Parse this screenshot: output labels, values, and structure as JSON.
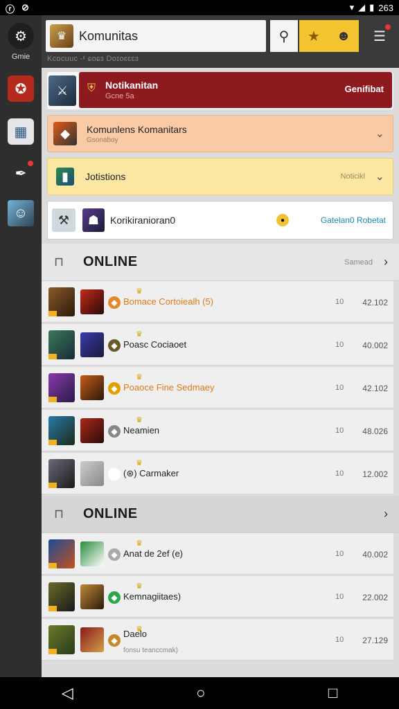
{
  "status": {
    "left1": "ⓡ",
    "left2": "⊘",
    "right": "263"
  },
  "rail": {
    "logo_label": "Gmie"
  },
  "topbar": {
    "title": "Komunitas",
    "subtitle": "Kcocuuc -ᵋ ɕoɕɜ Doɪoɛɛɛɜ"
  },
  "notif": {
    "title": "Notikanitan",
    "sub": "Gcne 5a",
    "right": "Genifibat"
  },
  "cards": [
    {
      "label": "Komunlens Komanitars",
      "sub": "Gsonaboy"
    },
    {
      "label": "Jotistions",
      "right": "Noticikl"
    },
    {
      "label": "Korikiranioran0",
      "right": "Gatelan0 Robetat"
    }
  ],
  "sections": [
    {
      "name": "ONLINE",
      "meta": "Samead"
    },
    {
      "name": "ONLINE",
      "meta": ""
    }
  ],
  "rows1": [
    {
      "name": "Bomace Cortoiealh (5)",
      "c1": "10",
      "c2": "42.102",
      "orange": true
    },
    {
      "name": "Poasc Cociaoet",
      "c1": "10",
      "c2": "40.002",
      "orange": false
    },
    {
      "name": "Poaoce Fine Sedmaey",
      "c1": "10",
      "c2": "42.102",
      "orange": true
    },
    {
      "name": "Neamien",
      "c1": "10",
      "c2": "48.026",
      "orange": false
    },
    {
      "name": "(⊛) Carmaker",
      "c1": "10",
      "c2": "12.002",
      "orange": false
    }
  ],
  "rows2": [
    {
      "name": "Anat de 2ef (e)",
      "c1": "10",
      "c2": "40.002"
    },
    {
      "name": "Kemnagiitaes)",
      "c1": "10",
      "c2": "22.002"
    },
    {
      "name": "Daelo",
      "sub": "fonsu teanccmak)",
      "c1": "10",
      "c2": "27.129"
    }
  ],
  "nav": {
    "back": "◁",
    "home": "○",
    "recent": "□"
  }
}
